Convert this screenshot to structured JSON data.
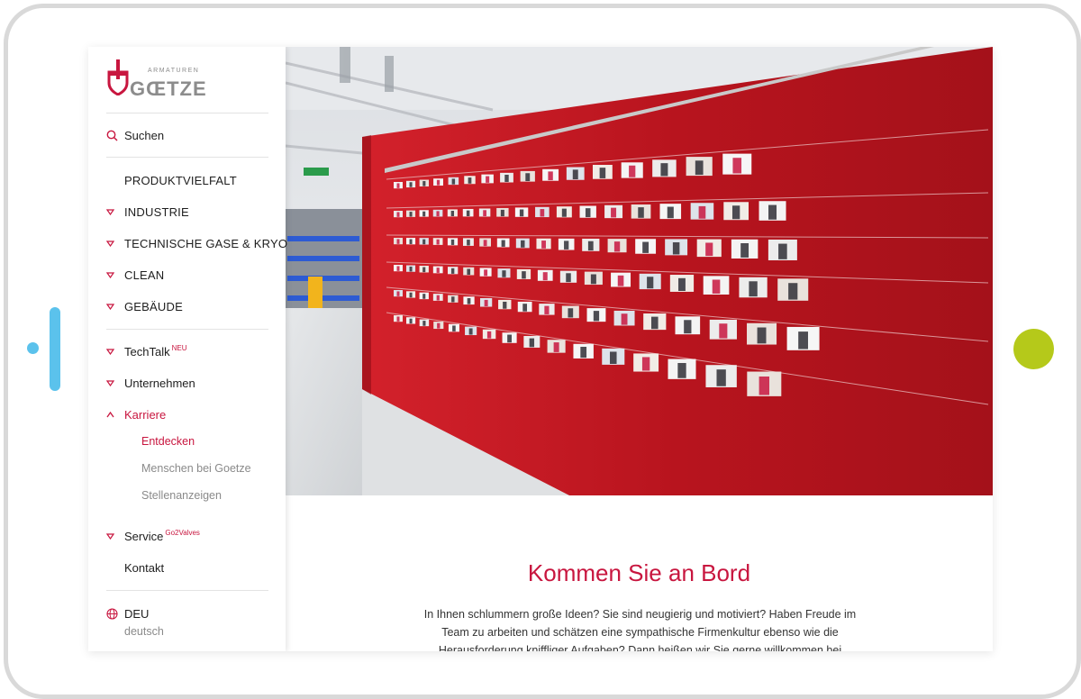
{
  "brand": {
    "name": "GŒTZE",
    "tagline": "ARMATUREN"
  },
  "sidebar": {
    "search_label": "Suchen",
    "sections": [
      {
        "label": "PRODUKTVIELFALT"
      },
      {
        "label": "INDUSTRIE"
      },
      {
        "label": "TECHNISCHE GASE & KRYO"
      },
      {
        "label": "CLEAN"
      },
      {
        "label": "GEBÄUDE"
      }
    ],
    "techtalk": {
      "label": "TechTalk",
      "badge": "NEU"
    },
    "unternehmen_label": "Unternehmen",
    "karriere": {
      "label": "Karriere",
      "children": [
        "Entdecken",
        "Menschen bei Goetze",
        "Stellenanzeigen"
      ]
    },
    "service": {
      "label": "Service",
      "badge": "Go2Valves"
    },
    "kontakt_label": "Kontakt",
    "language": {
      "code": "DEU",
      "name": "deutsch"
    }
  },
  "content": {
    "title": "Kommen Sie an Bord",
    "text": "In Ihnen schlummern große Ideen? Sie sind neugierig und motiviert? Haben Freude im Team zu arbeiten und schätzen eine sympathische Firmenkultur ebenso wie die Herausforderung kniffliger Aufgaben? Dann heißen wir Sie gerne willkommen bei GOETZE."
  },
  "colors": {
    "accent": "#c8163f",
    "wall_red": "#b8141e",
    "frame_gray": "#d9d9d9",
    "camera_blue": "#5bc2ec",
    "home_button_green": "#b5c91a"
  },
  "icons": [
    "search-icon",
    "chevron-down-icon",
    "chevron-up-icon",
    "globe-icon"
  ]
}
